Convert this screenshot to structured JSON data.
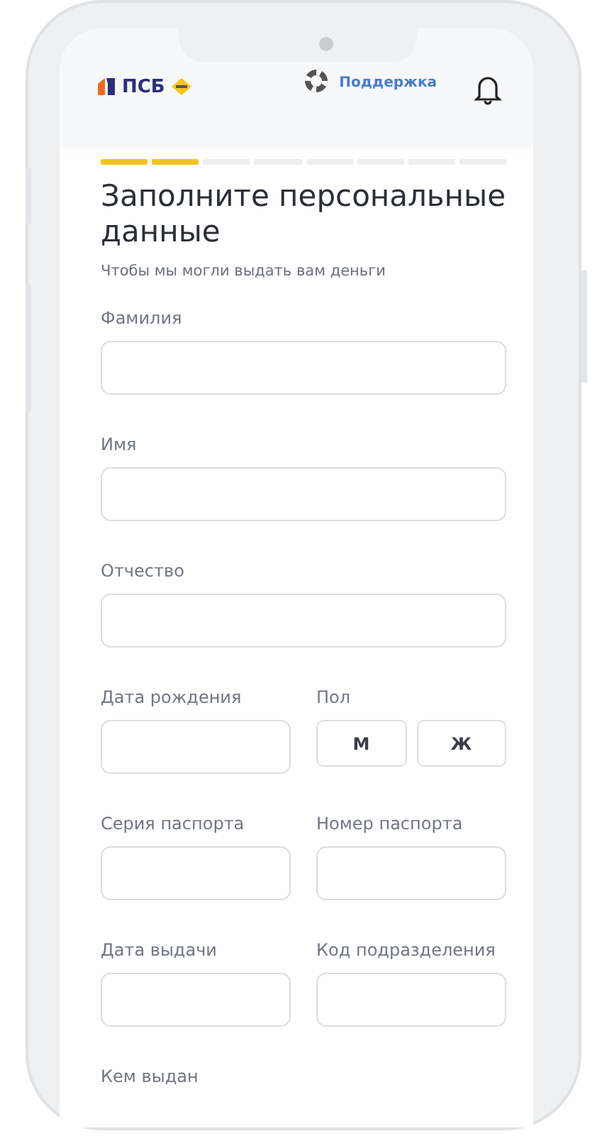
{
  "header": {
    "logo": "ПСБ",
    "support": "Поддержка"
  },
  "steps": [
    {
      "done": true
    },
    {
      "done": true
    },
    {
      "done": false
    },
    {
      "done": false
    },
    {
      "done": false
    },
    {
      "done": false
    },
    {
      "done": false
    },
    {
      "done": false
    }
  ],
  "title": "Заполните персональные данные",
  "subtitle": "Чтобы мы могли выдать вам деньги",
  "rows": [
    [
      {
        "kind": "input",
        "label": "Фамилия"
      }
    ],
    [
      {
        "kind": "input",
        "label": "Имя"
      }
    ],
    [
      {
        "kind": "input",
        "label": "Отчество"
      }
    ],
    [
      {
        "kind": "input",
        "label": "Дата рождения"
      },
      {
        "kind": "choice",
        "label": "Пол",
        "options": [
          {
            "label": "М",
            "selected": false
          },
          {
            "label": "Ж",
            "selected": false
          }
        ]
      }
    ],
    [
      {
        "kind": "input",
        "label": "Серия паспорта"
      },
      {
        "kind": "input",
        "label": "Номер паспорта"
      }
    ],
    [
      {
        "kind": "input",
        "label": "Дата выдачи"
      },
      {
        "kind": "input",
        "label": "Код подразделения"
      }
    ],
    [
      {
        "kind": "label",
        "label": "Кем выдан"
      }
    ]
  ]
}
